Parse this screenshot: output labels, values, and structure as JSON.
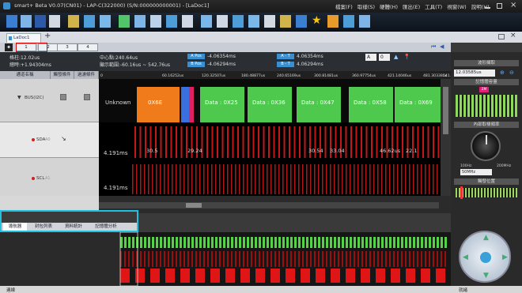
{
  "titlebar": {
    "title": "smart+ Beta V0.07(CN01) - LAP-C(322000) (S/N:000000000001) - [LaDoc1]",
    "menu": [
      "檔案(F)",
      "取樣(S)",
      "硬體(H)",
      "匯出(E)",
      "工具(T)",
      "視窗(W)",
      "說明(H)"
    ]
  },
  "tabbar": {
    "doc_tab": "LaDoc1",
    "add": "+"
  },
  "navbar": {
    "pages": [
      "1",
      "2",
      "3",
      "4"
    ],
    "current": "1"
  },
  "inforow": {
    "interval": "格柱:12.02us",
    "total": "總時:+1.94304ms",
    "center": "中心點:240.64us",
    "display_range": "顯示範圍:-60.16us ~ 542.76us",
    "a_pos_label": "A Pos",
    "a_pos": "-4.06354ms",
    "b_pos_label": "B Pos",
    "b_pos": "-4.06294ms",
    "a_t_label": "A - T",
    "a_t": "4.06354ms",
    "b_t_label": "B - T",
    "b_t": "4.06294ms",
    "sel_a": "A",
    "sel_val": "0"
  },
  "channels": {
    "headers": [
      "通道名稱",
      "觸發條件",
      "過濾條件"
    ],
    "rows": [
      {
        "name": "BUS(I2C)"
      },
      {
        "name": "SDA",
        "suffix": "A0"
      },
      {
        "name": "SCL",
        "suffix": "A1"
      }
    ]
  },
  "ruler": [
    "0",
    "60.16252us",
    "120.32507us",
    "180.48877us",
    "240.65169us",
    "300.81481us",
    "360.97754us",
    "421.14046us",
    "481.30338us",
    "541.4"
  ],
  "bus": [
    {
      "label": "Unknown",
      "color": "#2a2a2a"
    },
    {
      "label": "0X6E",
      "color": "#f07b1a"
    },
    {
      "label": "Data : 0X25",
      "color": "#4ec94e"
    },
    {
      "label": "Data : 0X36",
      "color": "#4ec94e"
    },
    {
      "label": "Data : 0X47",
      "color": "#4ec94e"
    },
    {
      "label": "Data : 0X58",
      "color": "#4ec94e"
    },
    {
      "label": "Data : 0X69",
      "color": "#4ec94e"
    }
  ],
  "sda_measures": {
    "period": "4.191ms",
    "marks": [
      "30.5",
      "29.24",
      "30.54",
      "33.04",
      "46.62us",
      "22.1"
    ]
  },
  "scl_measures": {
    "period": "4.191ms"
  },
  "bottom_tabs": [
    "導航器",
    "封包列表",
    "資料統計",
    "記憶體分析"
  ],
  "right": {
    "waveform_label": "波形擷取",
    "timebase": "12.03585us",
    "memory_label": "記憶體容量",
    "memory_marker": "2M",
    "clock_label": "內部取樣頻率",
    "clock_min": "100Hz",
    "clock_max": "200MHz",
    "clock_value": "50MHz",
    "trigger_label": "觸發位置"
  },
  "status": {
    "left": "連線",
    "right": "就緒"
  },
  "colors": {
    "accent": "#3a8fd0",
    "bus_green": "#4ec94e",
    "bus_orange": "#f07b1a",
    "signal_red": "#c2181a",
    "highlight": "#20c0e0"
  }
}
